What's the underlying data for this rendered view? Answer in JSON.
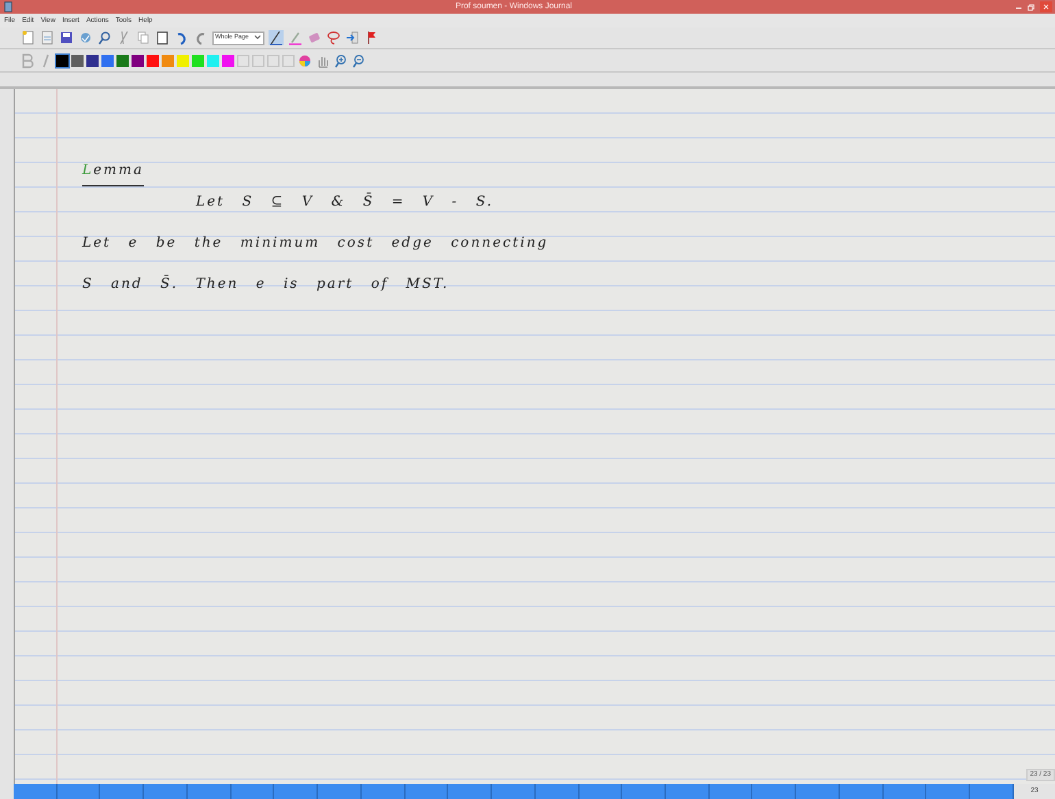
{
  "window": {
    "title": "Prof soumen - Windows Journal"
  },
  "menu": [
    "File",
    "Edit",
    "View",
    "Insert",
    "Actions",
    "Tools",
    "Help"
  ],
  "toolbar": {
    "zoom_select": "Whole Page"
  },
  "palette": [
    {
      "color": "#000000",
      "selected": true
    },
    {
      "color": "#606060",
      "selected": false
    },
    {
      "color": "#303090",
      "selected": false
    },
    {
      "color": "#3070f0",
      "selected": false
    },
    {
      "color": "#1a7a1a",
      "selected": false
    },
    {
      "color": "#800080",
      "selected": false
    },
    {
      "color": "#ff1010",
      "selected": false
    },
    {
      "color": "#f08a10",
      "selected": false
    },
    {
      "color": "#f0f000",
      "selected": false
    },
    {
      "color": "#20e020",
      "selected": false
    },
    {
      "color": "#20f0f0",
      "selected": false
    },
    {
      "color": "#f010f0",
      "selected": false
    }
  ],
  "ink": [
    {
      "kind": "heading",
      "text": "Lemma"
    },
    {
      "kind": "statement",
      "text": "Let S ⊆ V & S̄ = V - S."
    },
    {
      "kind": "body",
      "text": "Let e be the minimum cost edge connecting"
    },
    {
      "kind": "body",
      "text": "S and S̄. Then e is part of MST."
    }
  ],
  "page_counter": "23 / 23",
  "page_number": "23"
}
